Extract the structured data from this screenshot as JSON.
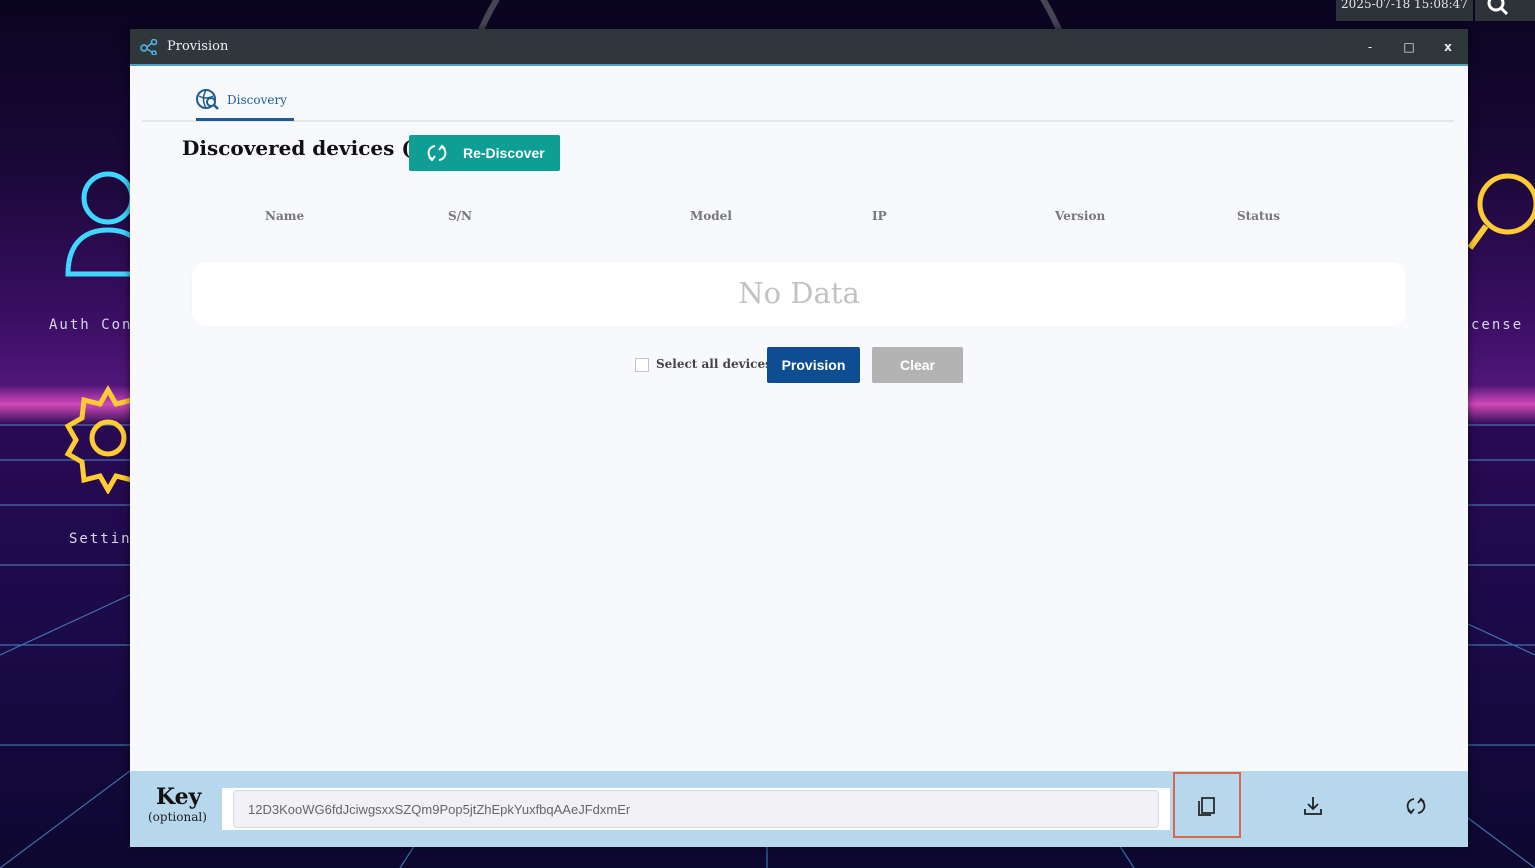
{
  "desktop": {
    "clock": "2025-07-18 15:08:47",
    "icons": [
      {
        "label": "Auth Con",
        "icon": "user-icon"
      },
      {
        "label": "Settin",
        "icon": "gear-icon"
      },
      {
        "label": "cense",
        "icon": "magnifier-icon"
      }
    ]
  },
  "window": {
    "title": "Provision",
    "controls": {
      "minimize": "-",
      "maximize": "□",
      "close": "x"
    }
  },
  "tabs": [
    {
      "label": "Discovery",
      "icon": "globe-search-icon",
      "active": true
    }
  ],
  "discovery": {
    "heading": "Discovered devices (0)",
    "rediscover_label": "Re-Discover",
    "columns": [
      "Name",
      "S/N",
      "Model",
      "IP",
      "Version",
      "Status"
    ],
    "empty_text": "No Data",
    "select_all_label": "Select all devices",
    "select_all_checked": false,
    "provision_label": "Provision",
    "clear_label": "Clear"
  },
  "keybar": {
    "title": "Key",
    "subtitle": "(optional)",
    "key_value": "12D3KooWG6fdJciwgsxxSZQm9Pop5jtZhEpkYuxfbqAAeJFdxmEr",
    "tools": [
      "copy-icon",
      "download-icon",
      "refresh-icon"
    ]
  },
  "colors": {
    "titlebar": "#2f373b",
    "accent_blue": "#1f5c94",
    "rediscover": "#0f9e93",
    "provision": "#0f4d92",
    "clear": "#b3b3b3",
    "keybar": "#b7d7ec",
    "copy_highlight": "#d5694e"
  }
}
